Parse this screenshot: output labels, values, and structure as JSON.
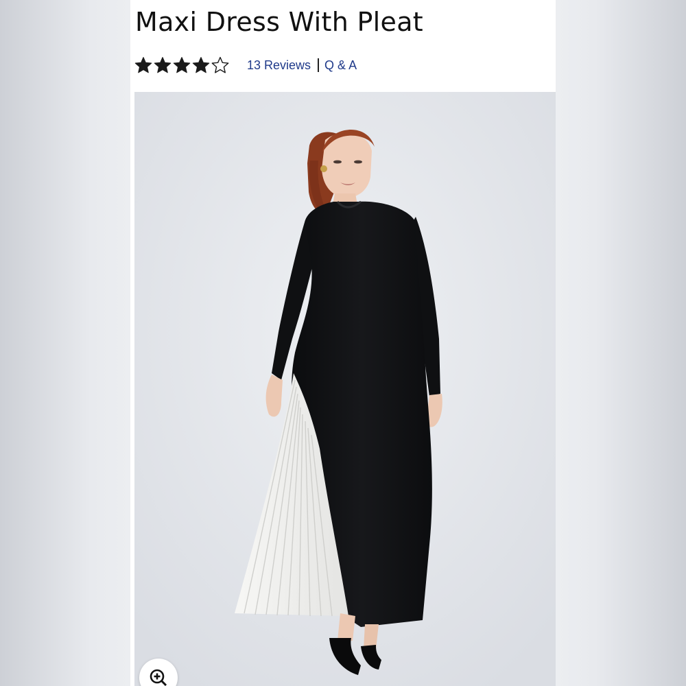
{
  "product": {
    "title": "Maxi Dress With Pleat",
    "rating": 4,
    "rating_max": 5,
    "reviews_label": "13 Reviews",
    "qa_label": "Q & A",
    "image_subject": "model-wearing-black-maxi-dress-with-white-pleat"
  },
  "colors": {
    "title_text": "#111111",
    "link": "#1f3a8a",
    "star_filled": "#1a1a1a",
    "dress": "#101113",
    "pleat": "#f4f4f2",
    "backdrop": "#e6e8ec"
  },
  "icons": {
    "star_filled": "star-filled-icon",
    "star_empty": "star-outline-icon",
    "zoom": "zoom-in-icon"
  }
}
